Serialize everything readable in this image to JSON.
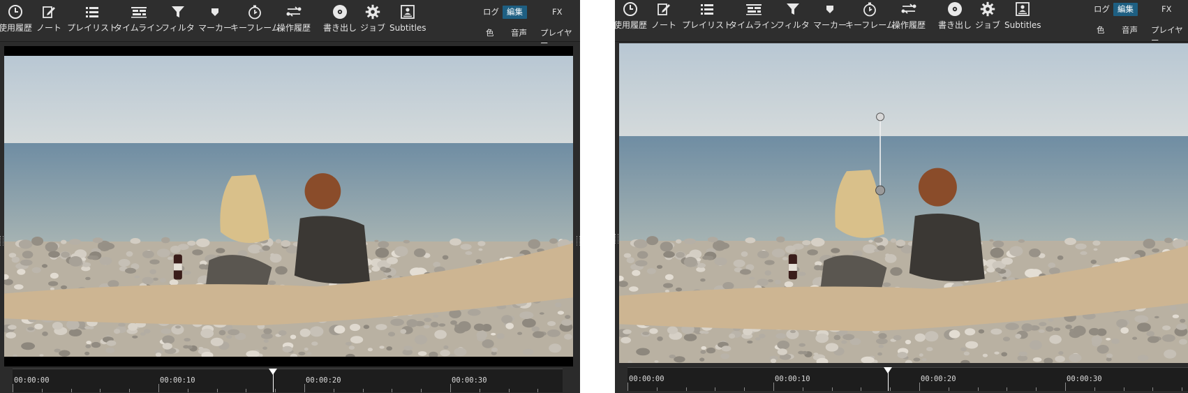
{
  "toolbar": {
    "items": [
      {
        "label": "使用履歴",
        "icon": "clock-icon"
      },
      {
        "label": "ノート",
        "icon": "note-edit-icon"
      },
      {
        "label": "プレイリスト",
        "icon": "list-icon"
      },
      {
        "label": "タイムライン",
        "icon": "timeline-icon"
      },
      {
        "label": "フィルタ",
        "icon": "filter-funnel-icon"
      },
      {
        "label": "マーカー",
        "icon": "marker-icon"
      },
      {
        "label": "キーフレーム",
        "icon": "stopwatch-icon"
      },
      {
        "label": "操作履歴",
        "icon": "history-arrows-icon"
      },
      {
        "label": "書き出し",
        "icon": "disc-icon"
      },
      {
        "label": "ジョブ",
        "icon": "gear-icon"
      },
      {
        "label": "Subtitles",
        "icon": "subtitles-icon"
      }
    ],
    "workspaces": {
      "log": "ログ",
      "edit": "編集",
      "fx": "FX",
      "color": "色",
      "audio": "音声",
      "player": "プレイヤー"
    }
  },
  "timeline": {
    "labels": [
      "00:00:00",
      "00:00:10",
      "00:00:20",
      "00:00:30"
    ]
  },
  "colors": {
    "accent": "#1e5f82",
    "panel": "#2e2e2e",
    "background": "#2b2b2b"
  }
}
